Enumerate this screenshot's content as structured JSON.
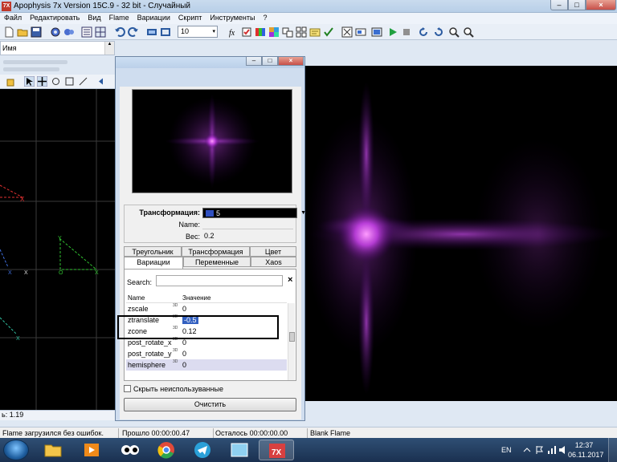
{
  "app": {
    "title": "Apophysis 7x Version 15C.9  - 32 bit - Случайный",
    "icon_text": "7X",
    "window_buttons": {
      "minimize": "–",
      "maximize": "□",
      "close": "×"
    }
  },
  "menu": [
    "Файл",
    "Редактировать",
    "Вид",
    "Flame",
    "Вариации",
    "Скрипт",
    "Инструменты",
    "?"
  ],
  "toolbar": {
    "density_value": "10",
    "density_arrow": "▾"
  },
  "tree": {
    "header": "Имя",
    "scroll_arrow": "▲"
  },
  "editor": {
    "status_text": "ь: 1.19"
  },
  "dialog": {
    "window_buttons": {
      "minimize": "–",
      "maximize": "□",
      "close": "×"
    },
    "transform_label": "Трансформация:",
    "transform_value": "5",
    "name_label": "Name:",
    "weight_label": "Вес:",
    "weight_value": "0.2",
    "tabs_row1": [
      "Треугольник",
      "Трансформация",
      "Цвет"
    ],
    "tabs_row2": [
      "Вариации",
      "Переменные",
      "Xaos"
    ],
    "search_label": "Search:",
    "search_clear": "×",
    "table_header": {
      "name": "Name",
      "value": "Значение"
    },
    "badge": "3D",
    "rows": [
      {
        "name": "zscale",
        "value": "0"
      },
      {
        "name": "ztranslate",
        "value": "-0.5"
      },
      {
        "name": "zcone",
        "value": "0.12"
      },
      {
        "name": "post_rotate_x",
        "value": "0"
      },
      {
        "name": "post_rotate_y",
        "value": "0"
      },
      {
        "name": "hemisphere",
        "value": "0"
      }
    ],
    "hide_unused_label": "Скрыть неиспользуванные",
    "clear_button": "Очистить"
  },
  "status": {
    "message": "Flame загрузился без ошибок.",
    "elapsed": "Прошло 00:00:00.47",
    "remaining": "Осталось 00:00:00.00",
    "flame_name": "Blank Flame"
  },
  "taskbar": {
    "language": "EN",
    "time": "12:37",
    "date": "06.11.2017"
  },
  "colors": {
    "accent": "#3050c0",
    "fractal": "#c040e0",
    "selection": "#dcdcf0"
  }
}
